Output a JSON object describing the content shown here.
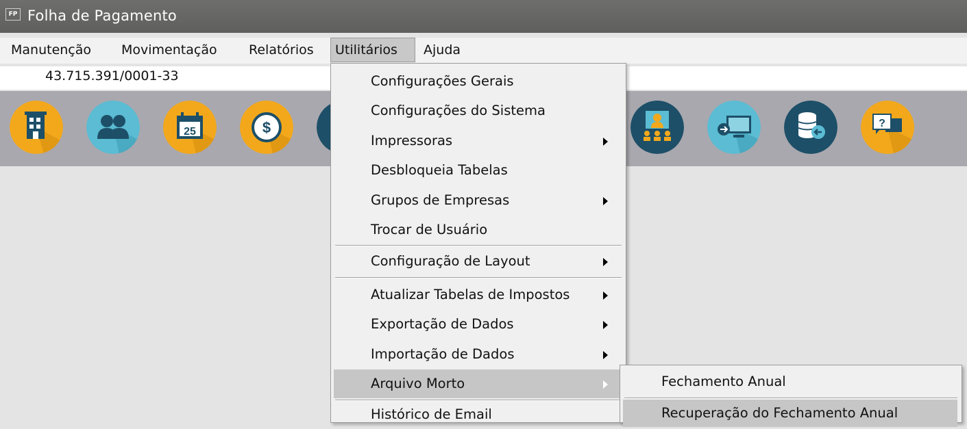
{
  "window": {
    "icon_text": "FP",
    "title": "Folha de Pagamento"
  },
  "menubar": {
    "items": [
      {
        "label": "Manutenção"
      },
      {
        "label": "Movimentação"
      },
      {
        "label": "Relatórios"
      },
      {
        "label": "Utilitários",
        "active": true
      },
      {
        "label": "Ajuda"
      }
    ]
  },
  "company": {
    "cnpj": "43.715.391/0001-33"
  },
  "toolbar": {
    "icons": [
      "company-building-icon",
      "employees-icon",
      "calendar-icon",
      "payment-dollar-icon",
      "hidden-icon",
      "users-meeting-icon",
      "monitor-connection-icon",
      "database-restore-icon",
      "help-chat-icon"
    ]
  },
  "utilitarios_menu": {
    "items": [
      {
        "label": "Configurações Gerais",
        "submenu": false
      },
      {
        "label": "Configurações do Sistema",
        "submenu": false
      },
      {
        "label": "Impressoras",
        "submenu": true
      },
      {
        "label": "Desbloqueia Tabelas",
        "submenu": false
      },
      {
        "label": "Grupos de Empresas",
        "submenu": true
      },
      {
        "label": "Trocar de Usuário",
        "submenu": false
      },
      {
        "label": "Configuração de Layout",
        "submenu": true
      },
      {
        "label": "Atualizar Tabelas de Impostos",
        "submenu": true
      },
      {
        "label": "Exportação de Dados",
        "submenu": true
      },
      {
        "label": "Importação de Dados",
        "submenu": true
      },
      {
        "label": "Arquivo Morto",
        "submenu": true,
        "highlighted": true
      },
      {
        "label": "Histórico de Email",
        "submenu": false
      }
    ]
  },
  "arquivo_morto_submenu": {
    "items": [
      {
        "label": "Fechamento Anual"
      },
      {
        "label": "Recuperação do Fechamento Anual",
        "highlighted": true
      }
    ]
  },
  "colors": {
    "titlebar": "#6a6a68",
    "toolbar": "#a9a8ae",
    "orange": "#f3a81c",
    "teal_light": "#5bbcd3",
    "teal_dark": "#1d4f68"
  }
}
